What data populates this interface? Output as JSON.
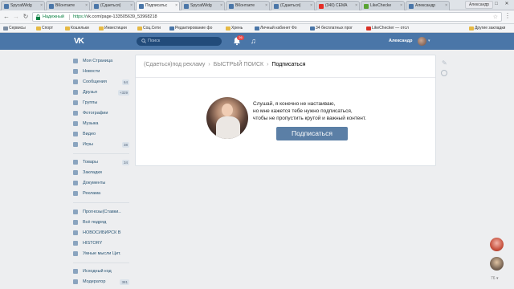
{
  "browser": {
    "tabs": [
      {
        "title": "SpycatWidg",
        "icon": "vk-icon"
      },
      {
        "title": "ВКонтакте",
        "icon": "vk-icon"
      },
      {
        "title": "(Сдаеться)",
        "icon": "vk-icon"
      },
      {
        "title": "Подписатьс",
        "icon": "vk-icon",
        "active": true
      },
      {
        "title": "SpycatWidg",
        "icon": "vk-icon"
      },
      {
        "title": "ВКонтакте",
        "icon": "vk-icon"
      },
      {
        "title": "(Сдаеться)",
        "icon": "vk-icon"
      },
      {
        "title": "(340) СЕМА",
        "icon": "youtube-icon"
      },
      {
        "title": "LikeChecke",
        "icon": "likechecker-icon"
      },
      {
        "title": "Александр",
        "icon": "vk-icon"
      }
    ],
    "profile_chip": "Александр",
    "secure_label": "Надежный",
    "url_protocol": "https://",
    "url_rest": "vk.com/page-133505639_53968218",
    "bookmarks": [
      {
        "label": "Сервисы",
        "icon": "grid"
      },
      {
        "label": "Спорт"
      },
      {
        "label": "Кошельки"
      },
      {
        "label": "Инвестиции"
      },
      {
        "label": "Соц.Сети"
      },
      {
        "label": "Редактирование фо",
        "icon": "blue"
      },
      {
        "label": "Хрень"
      },
      {
        "label": "Личный кабинет Фо",
        "icon": "blue"
      },
      {
        "label": "34 бесплатных прог",
        "icon": "blue"
      },
      {
        "label": "LikeChecker — отсл",
        "icon": "red"
      }
    ],
    "other_bookmarks": "Другие закладки"
  },
  "header": {
    "logo": "VK",
    "search_placeholder": "Поиск",
    "notifications_count": "26",
    "user_name": "Александр"
  },
  "sidebar": {
    "items": [
      {
        "label": "Моя Страница"
      },
      {
        "label": "Новости"
      },
      {
        "label": "Сообщения",
        "count": "64"
      },
      {
        "label": "Друзья",
        "count": "+329"
      },
      {
        "label": "Группы"
      },
      {
        "label": "Фотографии"
      },
      {
        "label": "Музыка"
      },
      {
        "label": "Видео"
      },
      {
        "label": "Игры",
        "count": "38"
      }
    ],
    "items2": [
      {
        "label": "Товары",
        "count": "34"
      },
      {
        "label": "Закладки"
      },
      {
        "label": "Документы"
      },
      {
        "label": "Реклама"
      }
    ],
    "items3": [
      {
        "label": "Прогнозы(Ставки..."
      },
      {
        "label": "Всё подряд"
      },
      {
        "label": "НОВОСИБИРСК В Д..."
      },
      {
        "label": "HISTORY"
      },
      {
        "label": "Умные мысли Цит..."
      }
    ],
    "items4": [
      {
        "label": "Исходный код"
      },
      {
        "label": "Модератор",
        "count": "381"
      }
    ]
  },
  "main": {
    "breadcrumb": [
      "(Сдаеться)под рекламу",
      "БЫСТРЫЙ ПОИСК",
      "Подписаться"
    ],
    "promo_lines": [
      "Слушай, я конечно не настаиваю,",
      "но мне кажется тебе нужно подписаться,",
      "чтобы не пропустить крутой и важный контент."
    ],
    "subscribe_label": "Подписаться"
  },
  "chats": {
    "count": "76"
  },
  "colors": {
    "vk_blue": "#4a76a8",
    "button": "#5b7fa6",
    "badge": "#e64646"
  }
}
